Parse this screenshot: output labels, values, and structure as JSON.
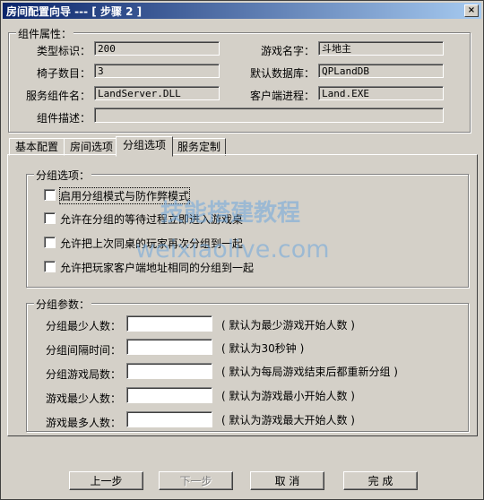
{
  "window": {
    "title": "房间配置向导 --- [ 步骤 2 ]",
    "close": "×"
  },
  "component": {
    "group_label": "组件属性：",
    "type_label": "类型标识：",
    "type_value": "200",
    "game_label": "游戏名字：",
    "game_value": "斗地主",
    "chairs_label": "椅子数目：",
    "chairs_value": "3",
    "db_label": "默认数据库：",
    "db_value": "QPLandDB",
    "service_label": "服务组件名：",
    "service_value": "LandServer.DLL",
    "client_label": "客户端进程：",
    "client_value": "Land.EXE",
    "desc_label": "组件描述：",
    "desc_value": ""
  },
  "tabs": [
    "基本配置",
    "房间选项",
    "分组选项",
    "服务定制"
  ],
  "group_options": {
    "label": "分组选项：",
    "items": [
      "启用分组模式与防作弊模式",
      "允许在分组的等待过程立即进入游戏桌",
      "允许把上次同桌的玩家再次分组到一起",
      "允许把玩家客户端地址相同的分组到一起"
    ]
  },
  "group_params": {
    "label": "分组参数：",
    "rows": [
      {
        "label": "分组最少人数：",
        "hint": "( 默认为最少游戏开始人数 )"
      },
      {
        "label": "分组间隔时间：",
        "hint": "( 默认为30秒钟 )"
      },
      {
        "label": "分组游戏局数：",
        "hint": "( 默认为每局游戏结束后都重新分组 )"
      },
      {
        "label": "游戏最少人数：",
        "hint": "( 默认为游戏最小开始人数 )"
      },
      {
        "label": "游戏最多人数：",
        "hint": "( 默认为游戏最大开始人数 )"
      }
    ]
  },
  "buttons": {
    "prev": "上一步",
    "next": "下一步",
    "cancel": "取 消",
    "finish": "完 成"
  },
  "watermark": {
    "line1": "技能搭建教程",
    "line2": "weixiaolive.com"
  }
}
